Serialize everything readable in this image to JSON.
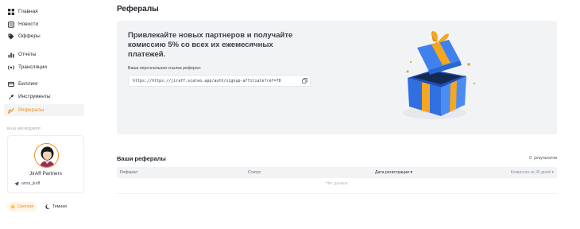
{
  "sidebar": {
    "items": [
      {
        "label": "Главная",
        "icon": "grid-icon"
      },
      {
        "label": "Новости",
        "icon": "news-icon"
      },
      {
        "label": "Офферы",
        "icon": "tag-icon"
      },
      {
        "label": "Отчеты",
        "icon": "bar-chart-icon"
      },
      {
        "label": "Трансляции",
        "icon": "broadcast-icon"
      },
      {
        "label": "Биллинг",
        "icon": "card-icon"
      },
      {
        "label": "Инструменты",
        "icon": "wrench-icon"
      },
      {
        "label": "Рефералы",
        "icon": "referral-icon",
        "active": true
      }
    ],
    "manager_label": "ВАШ МЕНЕДЖЕР",
    "manager": {
      "name": "JirAff Partners",
      "telegram": "anna_jiraff"
    },
    "theme": {
      "light_label": "Светлая",
      "dark_label": "Темная"
    }
  },
  "main": {
    "title": "Рефералы",
    "banner": {
      "heading": "Привлекайте новых партнеров и получайте комиссию 5% со всех их ежемесячных платежей.",
      "link_label": "Ваша персональная ссылка реферал:",
      "link_value": "https://https://jiraff.scaleo.app/auth/signup-affiliate?ref=78"
    },
    "referrals": {
      "title": "Ваши рефералы",
      "results_count": "0",
      "results_label": "результатов",
      "columns": [
        "Реферал",
        "Статус",
        "Дата регистрации ▾",
        "Комиссия за 30 дней ▾"
      ],
      "empty_text": "Нет данных"
    }
  },
  "colors": {
    "accent": "#f08c1a",
    "gift_blue": "#3b82f6",
    "gift_ribbon": "#f5a623"
  }
}
